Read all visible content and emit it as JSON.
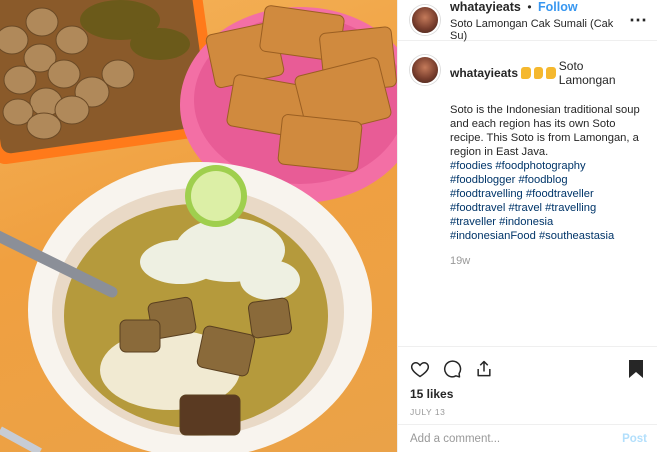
{
  "header": {
    "username": "whatayieats",
    "separator": "•",
    "follow_label": "Follow",
    "location": "Soto Lamongan Cak Sumali (Cak Su)",
    "more_icon": "more-horizontal-icon"
  },
  "caption": {
    "username": "whatayieats",
    "emoji": "thumbs-up x3",
    "title": "Soto Lamongan",
    "text": "Soto is the Indonesian traditional soup and each region has its own Soto recipe. This Soto is from Lamongan, a region in East Java.",
    "hashtags": [
      "#foodies",
      "#foodphotography",
      "#foodblogger",
      "#foodblog",
      "#foodtravelling",
      "#foodtraveller",
      "#foodtravel",
      "#travel",
      "#travelling",
      "#traveller",
      "#indonesia",
      "#indonesianFood",
      "#southeastasia"
    ],
    "age": "19w"
  },
  "actions": {
    "likes": "15 likes",
    "date": "JULY 13"
  },
  "comment": {
    "placeholder": "Add a comment...",
    "post_label": "Post"
  },
  "colors": {
    "link": "#3897f0",
    "hashtag": "#003569",
    "muted": "#999999",
    "table_orange": "#f0a040"
  },
  "image": {
    "subject": "Bowl of Soto Lamongan with lime, eggs and tempeh on an orange table"
  }
}
